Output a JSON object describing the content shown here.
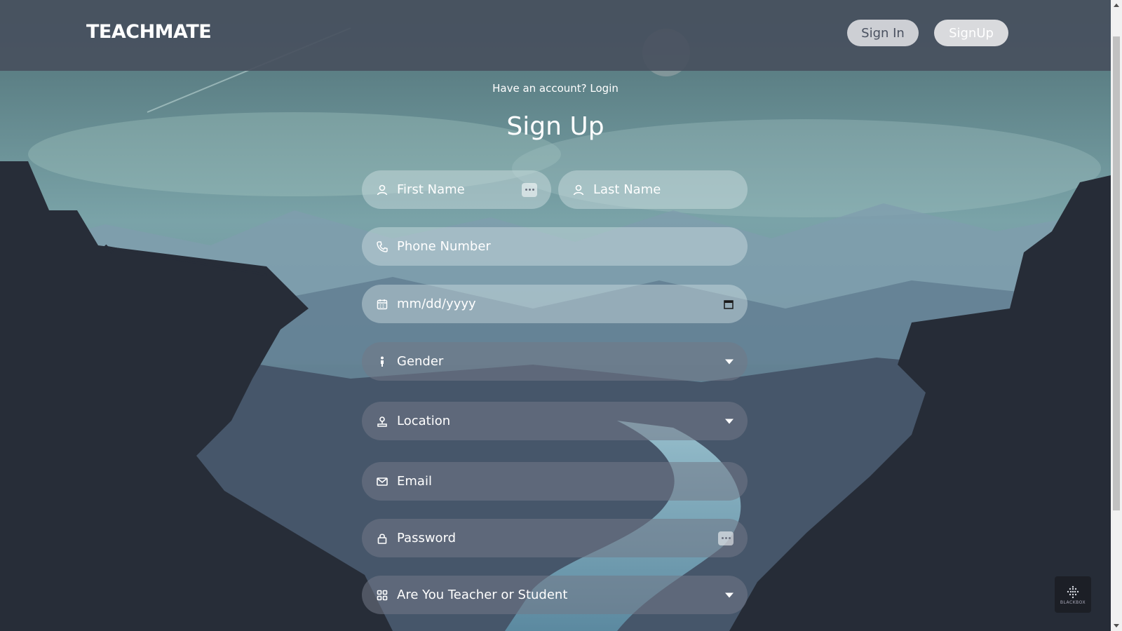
{
  "header": {
    "brand": "TEACHMATE",
    "signin_label": "Sign In",
    "signup_label": "SignUp"
  },
  "form": {
    "have_account": "Have an account?  Login",
    "title": "Sign Up",
    "first_name_placeholder": "First Name",
    "last_name_placeholder": "Last Name",
    "phone_placeholder": "Phone Number",
    "date_placeholder": "mm/dd/yyyy",
    "gender_selected": "Gender",
    "location_selected": "Location",
    "email_placeholder": "Email",
    "password_placeholder": "Password",
    "role_selected": "Are You Teacher or Student"
  },
  "badge": {
    "label": "BLACKBOX"
  },
  "colors": {
    "navbar": "#48505e",
    "field_light": "#d7e4e8",
    "field_dark": "#737887"
  },
  "icons": [
    "user-icon",
    "phone-icon",
    "calendar-icon",
    "gender-icon",
    "location-icon",
    "mail-icon",
    "lock-icon",
    "grid-icon",
    "password-dots-icon",
    "chevron-down-icon"
  ]
}
